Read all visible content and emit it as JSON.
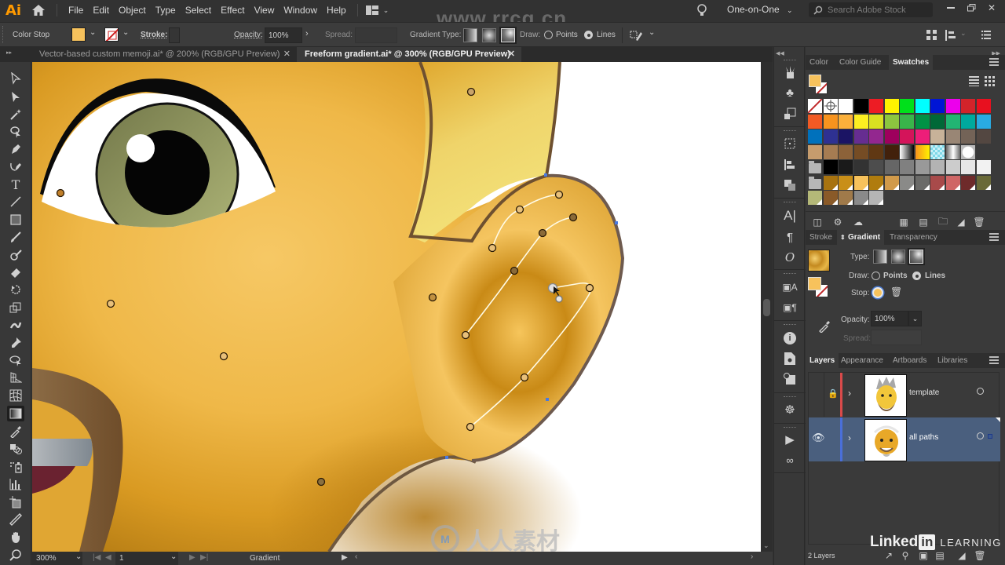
{
  "app": {
    "logo": "Ai",
    "menu": [
      "File",
      "Edit",
      "Object",
      "Type",
      "Select",
      "Effect",
      "View",
      "Window",
      "Help"
    ],
    "workspace": "One-on-One",
    "search_placeholder": "Search Adobe Stock",
    "watermark_top": "www.rrcg.cn"
  },
  "control_bar": {
    "mode_label": "Color Stop",
    "fill_color": "#f7c25c",
    "stroke_label": "Stroke:",
    "opacity_label": "Opacity:",
    "opacity_value": "100%",
    "spread_label": "Spread:",
    "gradient_type_label": "Gradient Type:",
    "draw_label": "Draw:",
    "draw_options": [
      "Points",
      "Lines"
    ],
    "draw_selected": "Lines"
  },
  "document_tabs": [
    {
      "title": "Vector-based custom memoji.ai* @ 200% (RGB/GPU Preview)",
      "active": false
    },
    {
      "title": "Freeform gradient.ai* @ 300% (RGB/GPU Preview)",
      "active": true
    }
  ],
  "status_bar": {
    "zoom": "300%",
    "artboard": "1",
    "current_tool": "Gradient"
  },
  "swatches_panel": {
    "tabs": [
      "Color",
      "Color Guide",
      "Swatches"
    ],
    "active_tab": "Swatches",
    "fill": "#f7c25c",
    "rows": [
      [
        "none",
        "registration",
        "#ffffff",
        "#000000",
        "#ed1c24",
        "#fff200",
        "#00e01b",
        "#00ffff",
        "#0015d5",
        "#ec00ec",
        "#d2232a",
        "#e8101f"
      ],
      [
        "#f15a24",
        "#f7931e",
        "#fbb03b",
        "#fcee21",
        "#d9e021",
        "#8cc63f",
        "#39b54a",
        "#009245",
        "#006837",
        "#22b573",
        "#00a99d",
        "#29abe2"
      ],
      [
        "#0071bc",
        "#2e3192",
        "#1b1464",
        "#662d91",
        "#93278f",
        "#9e005d",
        "#d4145a",
        "#ed1e79",
        "#c7b299",
        "#998675",
        "#736357",
        "#534741"
      ],
      [
        "#c69c6d",
        "#a67c52",
        "#8c6239",
        "#754c24",
        "#603813",
        "#42210b",
        "grad-bw",
        "grad-orange",
        "pattern-blue",
        "grad-silver",
        "pattern-dots"
      ],
      [
        "folder",
        "#000000",
        "#1a1a1a",
        "#333333",
        "#4d4d4d",
        "#666666",
        "#808080",
        "#999999",
        "#b3b3b3",
        "#cccccc",
        "#e6e6e6",
        "#f2f2f2"
      ],
      [
        "folder",
        "#a8730f",
        "#c98f18",
        "#f7c25c",
        "#b07c0e",
        "#d19a4a",
        "#8a8a88",
        "#6a6a68",
        "#a84a4a",
        "#cf6666",
        "#6e2a2a",
        "#6a6a38"
      ],
      [
        "#b4b878",
        "#8a5a28",
        "#a07a4a",
        "#8a8a8a",
        "#b5b5b5"
      ]
    ]
  },
  "gradient_panel": {
    "tabs": [
      "Stroke",
      "Gradient",
      "Transparency"
    ],
    "active_tab": "Gradient",
    "type_label": "Type:",
    "draw_label": "Draw:",
    "draw_options": [
      "Points",
      "Lines"
    ],
    "draw_selected": "Lines",
    "stop_label": "Stop:",
    "opacity_label": "Opacity:",
    "opacity_value": "100%",
    "spread_label": "Spread:"
  },
  "layers_panel": {
    "tabs": [
      "Layers",
      "Appearance",
      "Artboards",
      "Libraries"
    ],
    "active_tab": "Layers",
    "layers": [
      {
        "name": "template",
        "locked": true,
        "visible": false,
        "color": "#d94a4a",
        "selected": false
      },
      {
        "name": "all paths",
        "locked": false,
        "visible": true,
        "color": "#4a6fd9",
        "selected": true
      }
    ],
    "count": "2 Layers"
  },
  "branding": {
    "linkedin": "Linked",
    "linkedin_in": "in",
    "learning": "LEARNING",
    "watermark_bottom": "人人素材"
  }
}
